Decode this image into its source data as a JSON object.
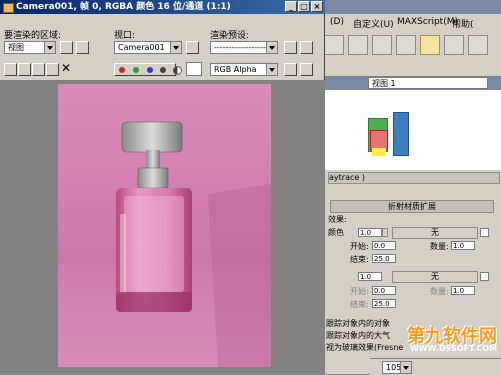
{
  "window": {
    "title": "Camera001, 帧 0, RGBA 颜色 16 位/通道 (1:1)"
  },
  "controls": {
    "area_label": "要渲染的区域:",
    "area_value": "视图",
    "viewport_label": "视口:",
    "viewport_value": "Camera001",
    "preset_label": "渲染预设:",
    "preset_value": "--------------------",
    "channel_value": "RGB Alpha"
  },
  "background_app": {
    "menus": [
      "(D)",
      "自定义(U)",
      "MAXScript(M)",
      "帮助("
    ],
    "viewport_dropdown": "视图 1",
    "section_header": "aytrace )",
    "rollout_title": "折射材质扩展",
    "effect_label": "效果:",
    "color_label": "颜色",
    "none_label": "无",
    "start_label": "开始:",
    "end_label": "结束:",
    "amount_label": "数量:",
    "values": {
      "spin1": "1.0",
      "start1": "0.0",
      "end1": "25.0",
      "amount1": "1.0",
      "spin2": "1.0",
      "start2": "0.0",
      "end2": "25.0",
      "amount2": "1.0"
    },
    "option1": "跟踪对象内的对象",
    "option2": "跟踪对象内的大气",
    "option3": "视为玻璃效果(Fresne",
    "zoom": "105%"
  },
  "watermark": {
    "text1": "第九软件网",
    "text2": "WWW.D9SOFT.COM"
  }
}
